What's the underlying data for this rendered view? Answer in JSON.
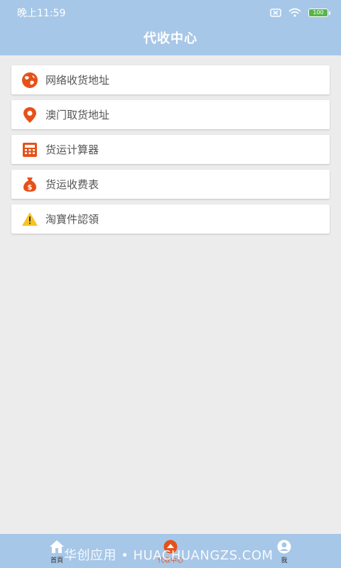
{
  "status_bar": {
    "time": "晚上11:59",
    "battery": "100"
  },
  "header": {
    "title": "代收中心"
  },
  "menu": [
    {
      "label": "网络收货地址",
      "icon": "globe-icon",
      "color": "#e65118"
    },
    {
      "label": "澳门取货地址",
      "icon": "location-pin-icon",
      "color": "#e65118"
    },
    {
      "label": "货运计算器",
      "icon": "calculator-icon",
      "color": "#e65118"
    },
    {
      "label": "货运收费表",
      "icon": "money-bag-icon",
      "color": "#e65118"
    },
    {
      "label": "淘寶件認領",
      "icon": "warning-icon",
      "color": "#f7c325"
    }
  ],
  "bottom_nav": {
    "tabs": [
      {
        "label": "首頁",
        "icon": "home-icon"
      },
      {
        "label": "代收中心",
        "icon": "package-icon",
        "active": true
      },
      {
        "label": "我",
        "icon": "user-icon"
      }
    ],
    "watermark": "华创应用 • HUACHUANGZS.COM"
  }
}
